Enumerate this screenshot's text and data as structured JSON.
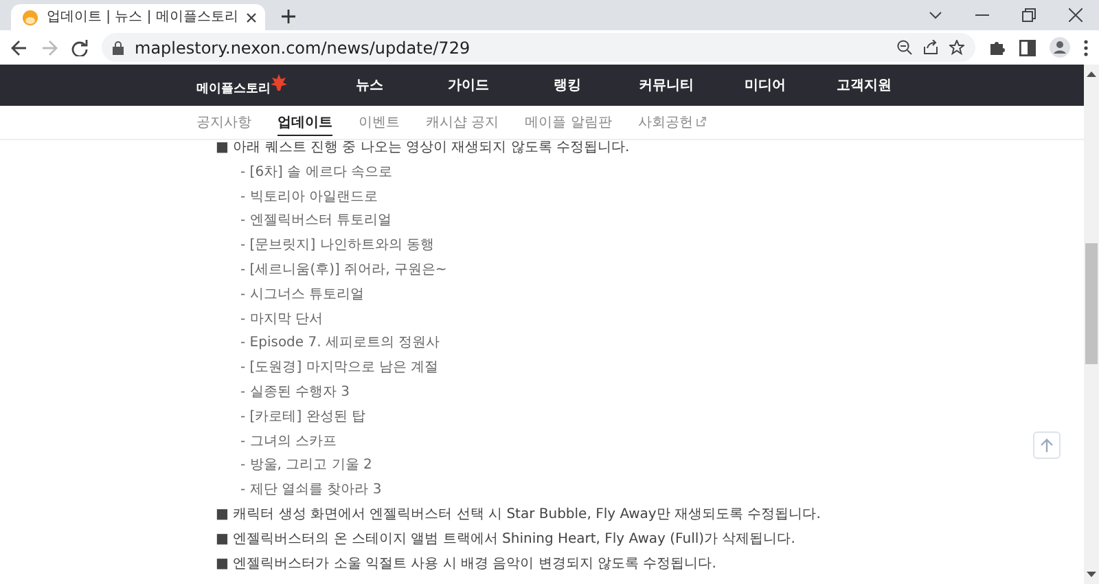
{
  "browser": {
    "tab_title": "업데이트 | 뉴스 | 메이플스토리",
    "url": "maplestory.nexon.com/news/update/729"
  },
  "site": {
    "logo": "메이플스토리",
    "nav": [
      "뉴스",
      "가이드",
      "랭킹",
      "커뮤니티",
      "미디어",
      "고객지원"
    ],
    "subnav": [
      {
        "label": "공지사항",
        "selected": false,
        "external": false
      },
      {
        "label": "업데이트",
        "selected": true,
        "external": false
      },
      {
        "label": "이벤트",
        "selected": false,
        "external": false
      },
      {
        "label": "캐시샵 공지",
        "selected": false,
        "external": false
      },
      {
        "label": "메이플 알림판",
        "selected": false,
        "external": false
      },
      {
        "label": "사회공헌",
        "selected": false,
        "external": true
      }
    ]
  },
  "notes": [
    {
      "text": "■ 아래 퀘스트 진행 중 나오는 영상이 재생되지 않도록 수정됩니다.",
      "items": [
        "- [6차] 솔 에르다 속으로",
        "- 빅토리아 아일랜드로",
        "- 엔젤릭버스터 튜토리얼",
        "- [문브릿지] 나인하트와의 동행",
        "- [세르니움(후)] 쥐어라, 구원은~",
        "- 시그너스 튜토리얼",
        "- 마지막 단서",
        "- Episode 7. 세피로트의 정원사",
        "- [도원경] 마지막으로 남은 계절",
        "- 실종된 수행자 3",
        "- [카로테] 완성된 탑",
        "- 그녀의 스카프",
        "- 방울, 그리고 기울 2",
        "- 제단 열쇠를 찾아라 3"
      ]
    },
    {
      "text": "■ 캐릭터 생성 화면에서 엔젤릭버스터 선택 시 Star Bubble, Fly Away만 재생되도록 수정됩니다."
    },
    {
      "text": "■ 엔젤릭버스터의 온 스테이지 앨범 트랙에서 Shining Heart, Fly Away (Full)가 삭제됩니다."
    },
    {
      "text": "■ 엔젤릭버스터가 소울 익절트 사용 시 배경 음악이 변경되지 않도록 수정됩니다."
    }
  ]
}
